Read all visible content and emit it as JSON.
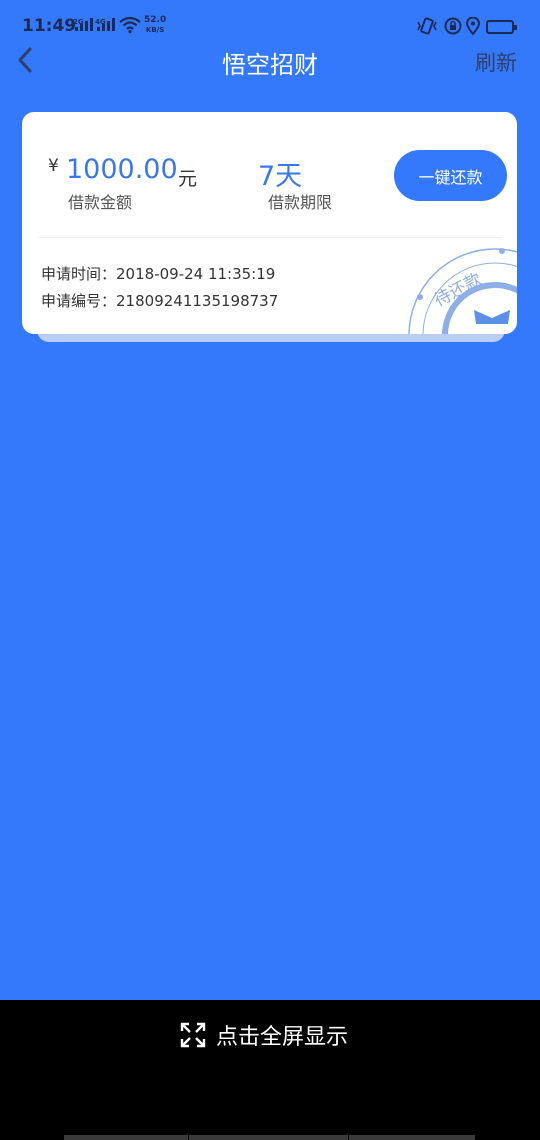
{
  "status_bar": {
    "time": "11:49",
    "network_1": "2G",
    "network_2": "4G",
    "speed_value": "52.0",
    "speed_unit": "KB/S"
  },
  "nav": {
    "title": "悟空招财",
    "refresh_label": "刷新"
  },
  "loan_card": {
    "currency_symbol": "¥",
    "amount": "1000.00",
    "amount_unit": "元",
    "amount_label": "借款金额",
    "term": "7天",
    "term_label": "借款期限",
    "repay_button": "一键还款",
    "apply_time_label": "申请时间：",
    "apply_time": "2018-09-24 11:35:19",
    "apply_no_label": "申请编号：",
    "apply_no": "21809241135198737",
    "stamp_text": "待还款"
  },
  "bottom": {
    "fullscreen_label": "点击全屏显示"
  },
  "colors": {
    "background": "#3478fb",
    "accent": "#3a78e8",
    "card": "#ffffff"
  }
}
